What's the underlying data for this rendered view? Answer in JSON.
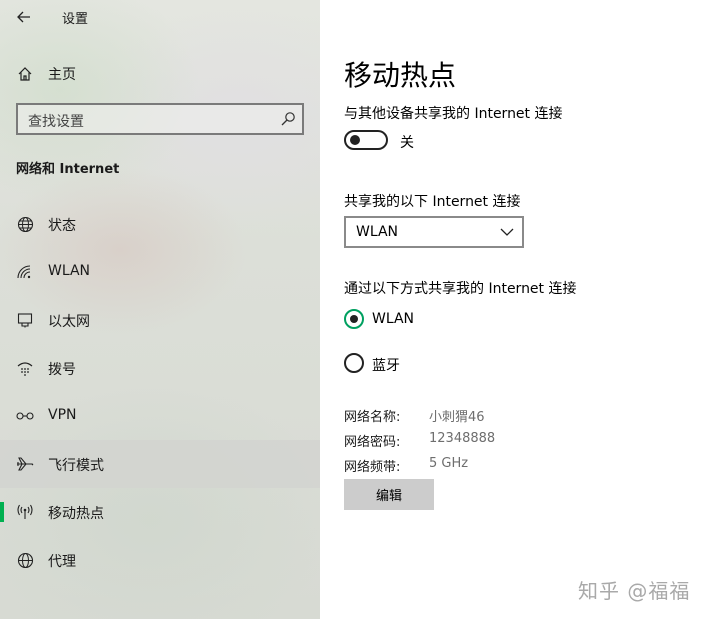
{
  "window": {
    "title": "设置"
  },
  "sidebar": {
    "home_label": "主页",
    "search_placeholder": "查找设置",
    "section_title": "网络和 Internet",
    "items": [
      {
        "label": "状态",
        "icon": "globe-status-icon"
      },
      {
        "label": "WLAN",
        "icon": "wifi-icon"
      },
      {
        "label": "以太网",
        "icon": "ethernet-icon"
      },
      {
        "label": "拨号",
        "icon": "dialup-icon"
      },
      {
        "label": "VPN",
        "icon": "vpn-icon"
      },
      {
        "label": "飞行模式",
        "icon": "airplane-icon"
      },
      {
        "label": "移动热点",
        "icon": "hotspot-icon"
      },
      {
        "label": "代理",
        "icon": "globe-icon"
      }
    ],
    "active_item": "移动热点",
    "accent_color": "#00b050"
  },
  "main": {
    "title": "移动热点",
    "share_label": "与其他设备共享我的 Internet 连接",
    "toggle_state": "关",
    "source_label": "共享我的以下 Internet 连接",
    "source_value": "WLAN",
    "via_label": "通过以下方式共享我的 Internet 连接",
    "via_options": [
      {
        "label": "WLAN",
        "selected": true
      },
      {
        "label": "蓝牙",
        "selected": false
      }
    ],
    "info": [
      {
        "key": "网络名称:",
        "value": "小刺猬46"
      },
      {
        "key": "网络密码:",
        "value": "12348888"
      },
      {
        "key": "网络频带:",
        "value": "5 GHz"
      }
    ],
    "edit_label": "编辑"
  },
  "watermark": "知乎 @福福"
}
